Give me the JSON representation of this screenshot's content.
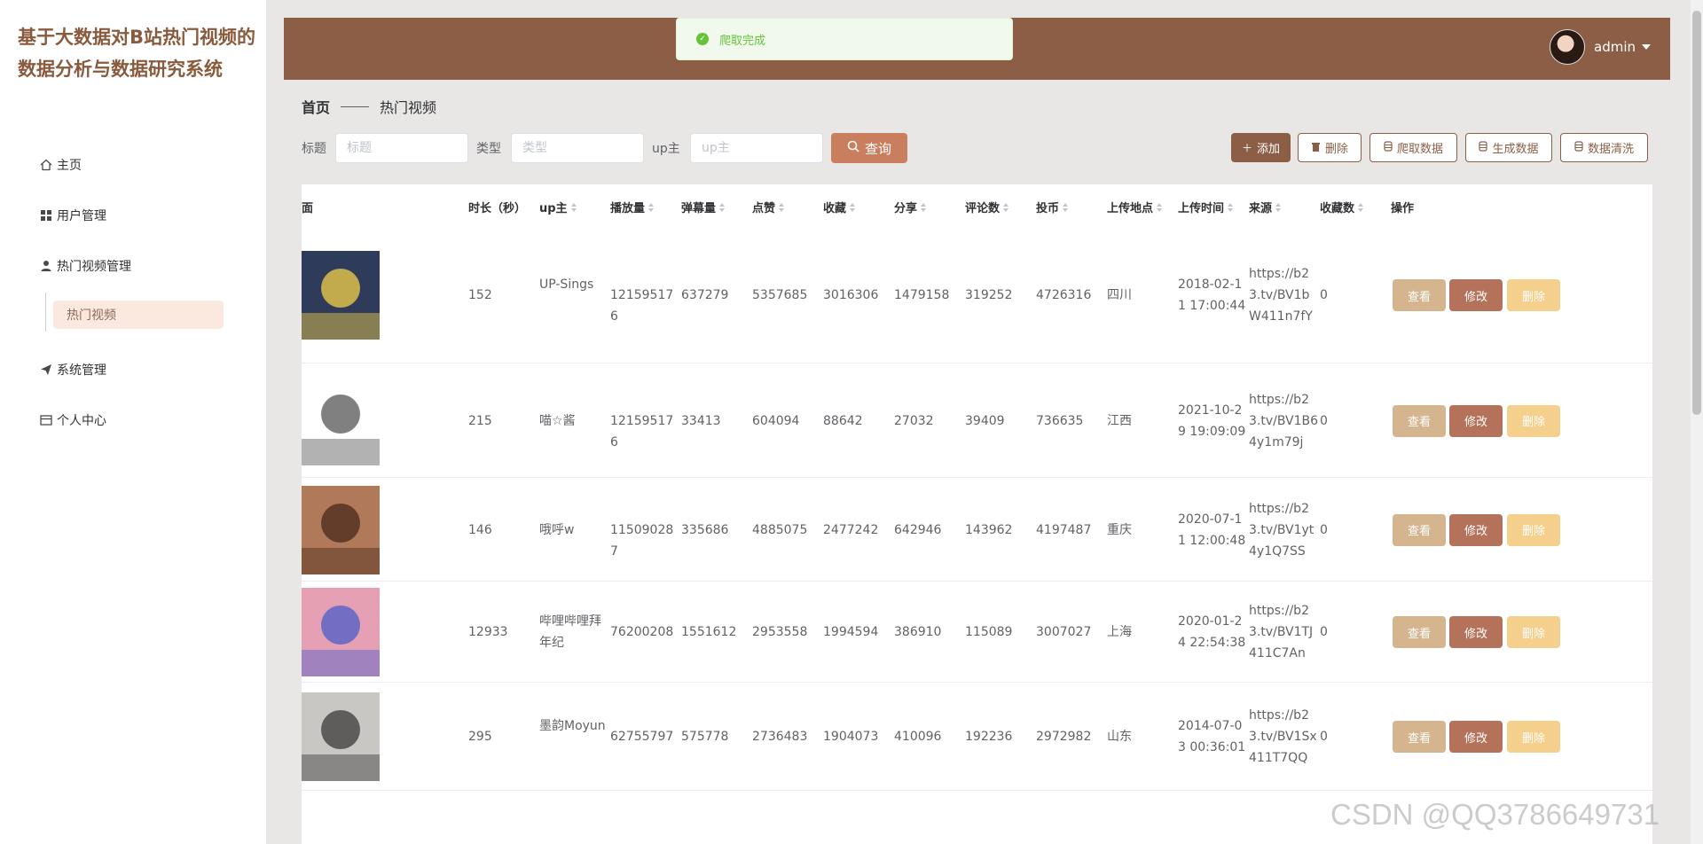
{
  "sidebar": {
    "brand": "基于大数据对B站热门视频的数据分析与数据研究系统",
    "items": [
      {
        "label": "主页",
        "icon": "home-icon"
      },
      {
        "label": "用户管理",
        "icon": "grid-icon"
      },
      {
        "label": "热门视频管理",
        "icon": "user-icon"
      },
      {
        "label": "系统管理",
        "icon": "send-icon"
      },
      {
        "label": "个人中心",
        "icon": "card-icon"
      }
    ],
    "submenu": {
      "label": "热门视频"
    }
  },
  "header": {
    "username": "admin",
    "toast": "爬取完成"
  },
  "breadcrumb": {
    "home": "首页",
    "current": "热门视频"
  },
  "search": {
    "title_label": "标题",
    "title_placeholder": "标题",
    "type_label": "类型",
    "type_placeholder": "类型",
    "up_label": "up主",
    "up_placeholder": "up主",
    "query_label": "查询"
  },
  "toolbar": {
    "add": "添加",
    "delete": "删除",
    "crawl": "爬取数据",
    "generate": "生成数据",
    "clean": "数据清洗"
  },
  "table": {
    "headers": [
      "面",
      "时长（秒）",
      "up主",
      "播放量",
      "弹幕量",
      "点赞",
      "收藏",
      "分享",
      "评论数",
      "投币",
      "上传地点",
      "上传时间",
      "来源",
      "收藏数",
      "操作"
    ],
    "ops": {
      "view": "查看",
      "edit": "修改",
      "del": "删除"
    },
    "rows": [
      {
        "duration": "152",
        "up": "UP-Sings",
        "play": "121595176",
        "danmu": "637279",
        "like": "5357685",
        "fav": "3016306",
        "share": "1479158",
        "comment": "319252",
        "coin": "4726316",
        "loc": "四川",
        "time": "2018-02-11 17:00:44",
        "src": "https://b23.tv/BV1bW411n7fY",
        "favcount": "0"
      },
      {
        "duration": "215",
        "up": "喵☆酱",
        "play": "121595176",
        "danmu": "33413",
        "like": "604094",
        "fav": "88642",
        "share": "27032",
        "comment": "39409",
        "coin": "736635",
        "loc": "江西",
        "time": "2021-10-29 19:09:09",
        "src": "https://b23.tv/BV1B64y1m79j",
        "favcount": "0"
      },
      {
        "duration": "146",
        "up": "哦呼w",
        "play": "115090287",
        "danmu": "335686",
        "like": "4885075",
        "fav": "2477242",
        "share": "642946",
        "comment": "143962",
        "coin": "4197487",
        "loc": "重庆",
        "time": "2020-07-11 12:00:48",
        "src": "https://b23.tv/BV1yt4y1Q7SS",
        "favcount": "0"
      },
      {
        "duration": "12933",
        "up": "哔哩哔哩拜年纪",
        "play": "76200208",
        "danmu": "1551612",
        "like": "2953558",
        "fav": "1994594",
        "share": "386910",
        "comment": "115089",
        "coin": "3007027",
        "loc": "上海",
        "time": "2020-01-24 22:54:38",
        "src": "https://b23.tv/BV1TJ411C7An",
        "favcount": "0"
      },
      {
        "duration": "295",
        "up": "墨韵Moyun",
        "play": "62755797",
        "danmu": "575778",
        "like": "2736483",
        "fav": "1904073",
        "share": "410096",
        "comment": "192236",
        "coin": "2972982",
        "loc": "山东",
        "time": "2014-07-03 00:36:01",
        "src": "https://b23.tv/BV1Sx411T7QQ",
        "favcount": "0"
      }
    ]
  },
  "watermark": "CSDN @QQ3786649731"
}
